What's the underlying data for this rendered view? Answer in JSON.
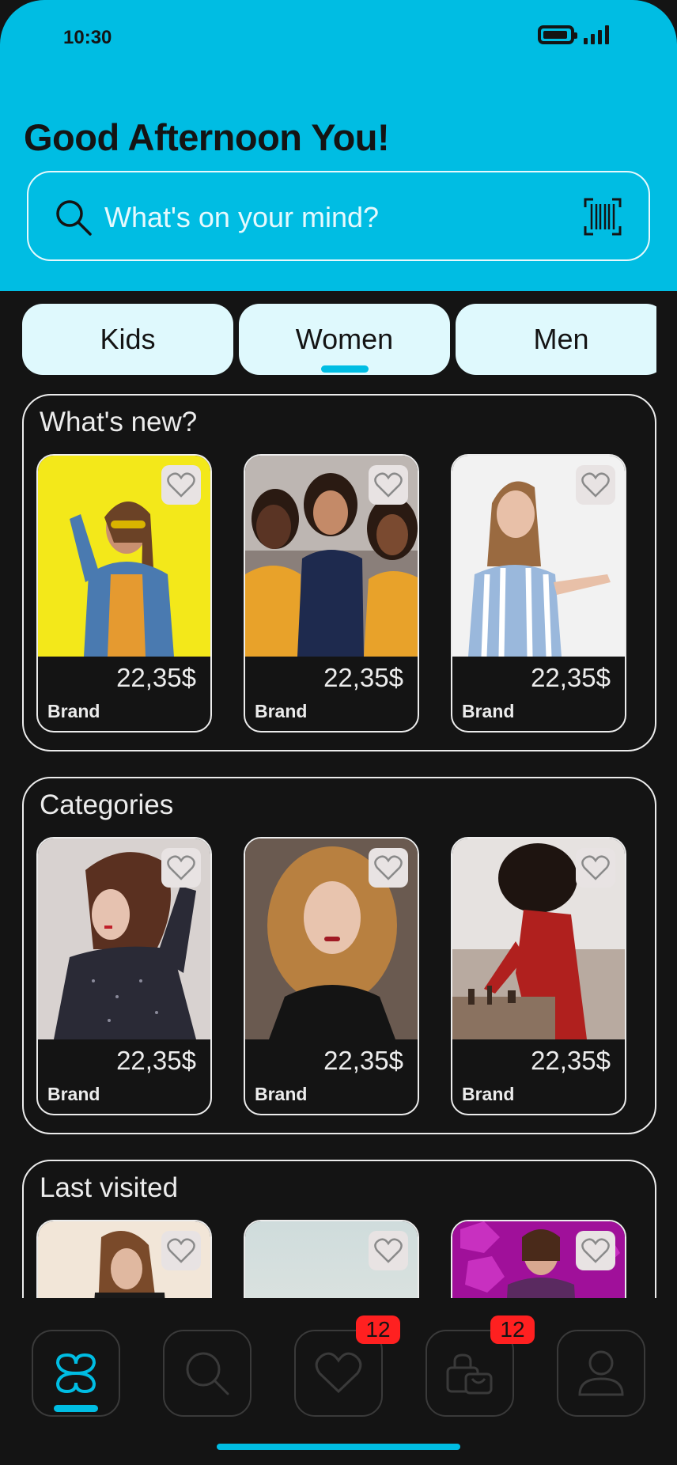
{
  "status_bar": {
    "time": "10:30"
  },
  "header": {
    "greeting": "Good Afternoon You!",
    "search_placeholder": "What's on your mind?"
  },
  "tabs": [
    {
      "label": "Kids",
      "selected": false
    },
    {
      "label": "Women",
      "selected": true
    },
    {
      "label": "Men",
      "selected": false
    }
  ],
  "sections": [
    {
      "title": "What's new?",
      "products": [
        {
          "price": "22,35$",
          "brand": "Brand"
        },
        {
          "price": "22,35$",
          "brand": "Brand"
        },
        {
          "price": "22,35$",
          "brand": "Brand"
        }
      ]
    },
    {
      "title": "Categories",
      "products": [
        {
          "price": "22,35$",
          "brand": "Brand"
        },
        {
          "price": "22,35$",
          "brand": "Brand"
        },
        {
          "price": "22,35$",
          "brand": "Brand"
        }
      ]
    },
    {
      "title": "Last visited",
      "products": [
        {
          "price": "",
          "brand": ""
        },
        {
          "price": "",
          "brand": ""
        },
        {
          "price": "",
          "brand": ""
        }
      ]
    }
  ],
  "bottom_nav": {
    "items": [
      {
        "icon": "home-logo-icon",
        "active": true
      },
      {
        "icon": "search-icon",
        "active": false
      },
      {
        "icon": "heart-icon",
        "badge": "12",
        "active": false
      },
      {
        "icon": "shopping-bag-icon",
        "badge": "12",
        "active": false
      },
      {
        "icon": "user-icon",
        "active": false
      }
    ]
  },
  "colors": {
    "accent": "#00bde3",
    "background": "#141414",
    "tab_background": "#dff9fd",
    "badge": "#ff2020",
    "outline": "#ececec"
  }
}
